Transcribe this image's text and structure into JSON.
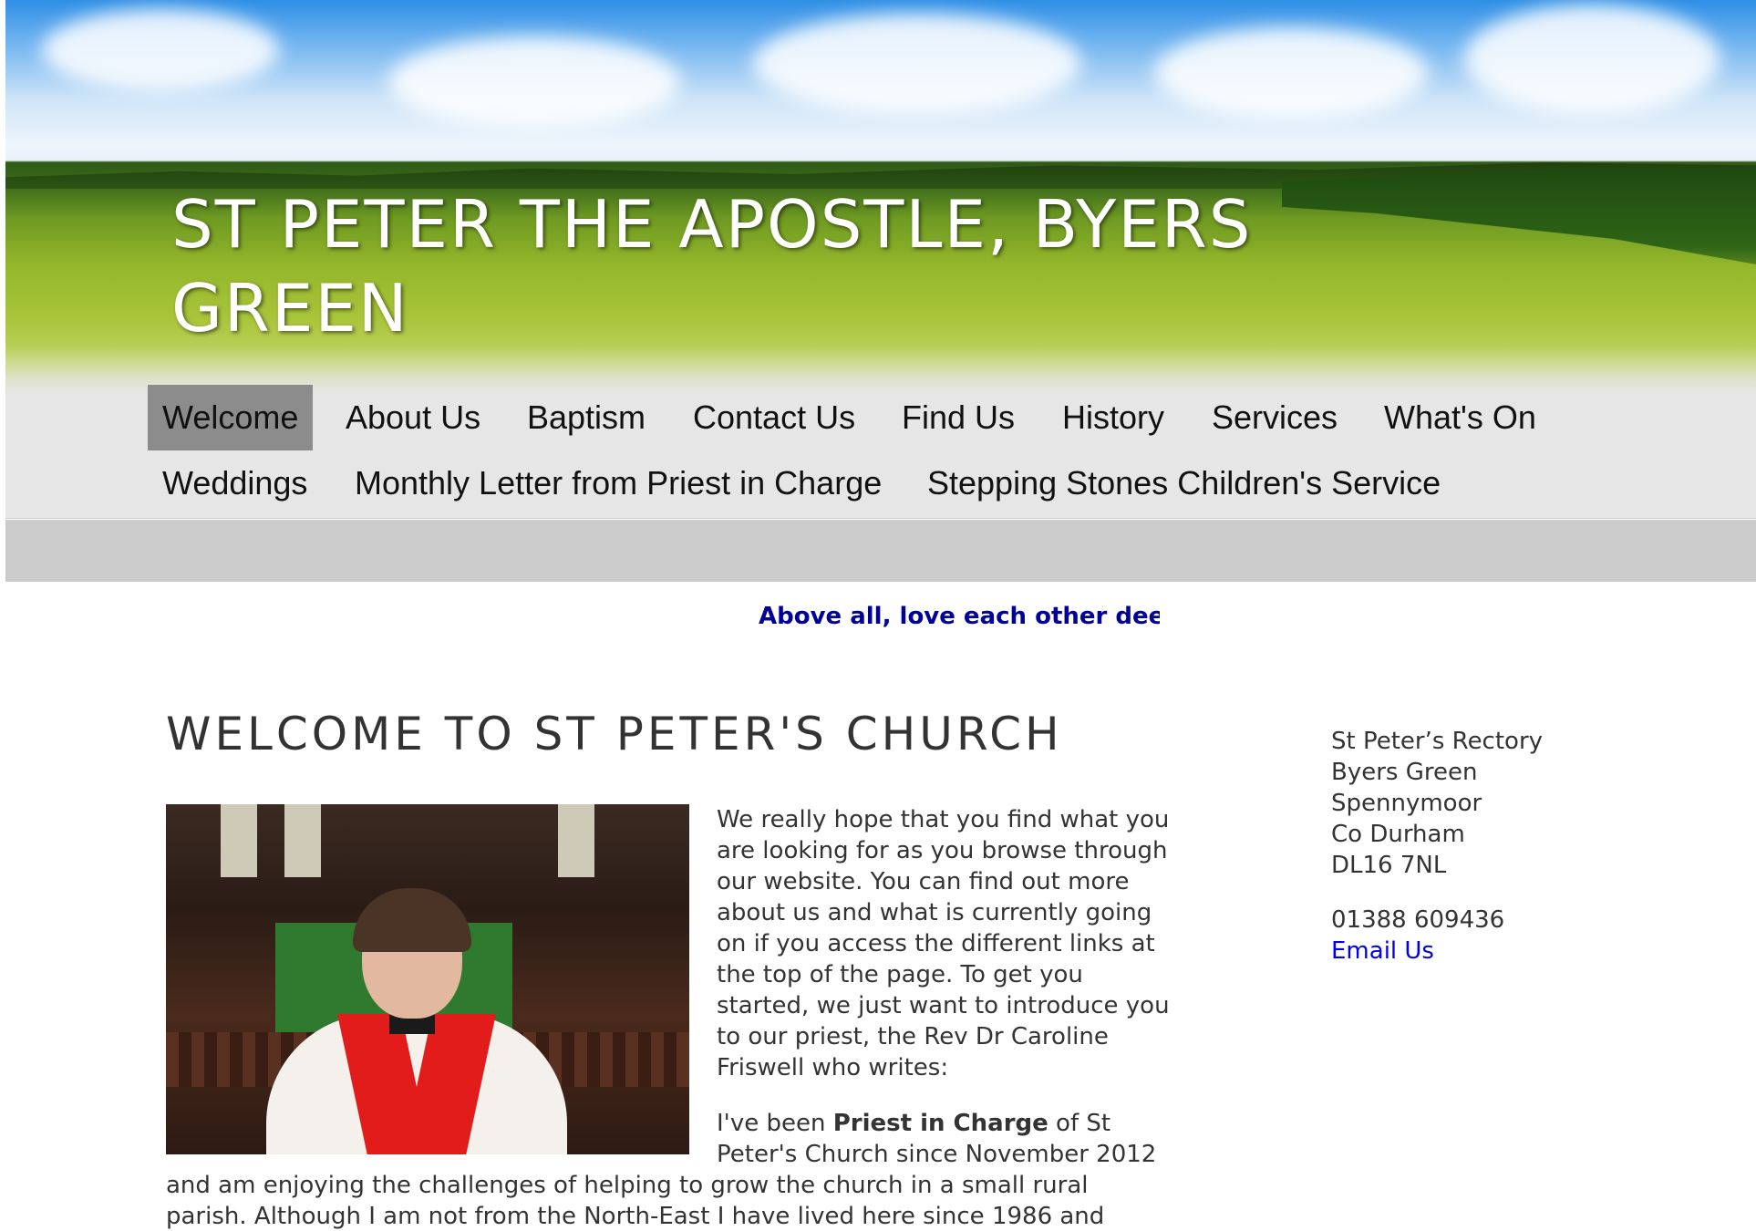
{
  "site": {
    "title_line1": "ST PETER THE APOSTLE, BYERS",
    "title_line2": "GREEN"
  },
  "nav": {
    "row1": [
      "Welcome",
      "About Us",
      "Baptism",
      "Contact Us",
      "Find Us",
      "History",
      "Services",
      "What's On"
    ],
    "row2": [
      "Weddings",
      "Monthly Letter from Priest in Charge",
      "Stepping Stones Children's Service"
    ],
    "active": "Welcome"
  },
  "marquee": {
    "text": "Above all, love each other dee"
  },
  "main": {
    "heading": "WELCOME TO ST PETER'S CHURCH",
    "intro": "We really hope that you find what you are looking for as you browse through our website.  You can find out more about us and what is currently going on if you access the different links at the top of the page.  To get you started, we just want to introduce you to our priest, the Rev Dr Caroline Friswell who writes:",
    "letter_prefix": "I've been ",
    "letter_bold": "Priest in Charge",
    "letter_suffix": " of St Peter's Church since November 2012",
    "letter_continued_1": "and am enjoying the challenges of helping to grow the church in a small rural",
    "letter_continued_2": "parish.  Although I am not from the North-East I have lived here since 1986 and"
  },
  "sidebar": {
    "address": [
      "St Peter’s Rectory",
      "Byers Green",
      "Spennymoor",
      "Co Durham",
      "DL16 7NL"
    ],
    "phone": "01388 609436",
    "email_label": "Email Us"
  },
  "colors": {
    "accent_link": "#0000ee",
    "marquee_text": "#000099",
    "nav_active_bg": "#8c8c8c",
    "nav_bg": "#e6e6e6"
  }
}
